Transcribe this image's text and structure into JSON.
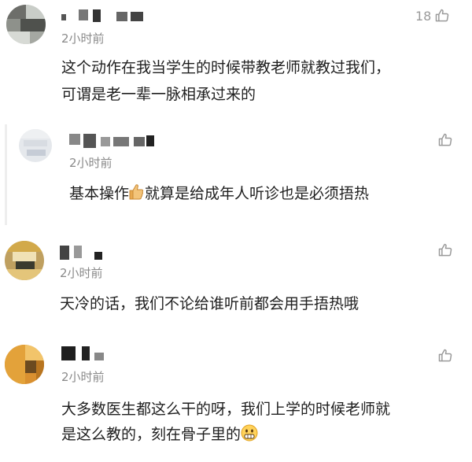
{
  "comments": [
    {
      "time": "2小时前",
      "text_lines": [
        "这个动作在我当学生的时候带教老师就教过我们，",
        "可谓是老一辈一脉相承过来的"
      ],
      "likes": "18",
      "like_icon": "thumbs-up-outline-icon",
      "avatar_colors": [
        "#6d6e6a",
        "#c9cdc8",
        "#8e918b",
        "#4f514d",
        "#d7dad5",
        "#a5a8a2"
      ]
    },
    {
      "time": "2小时前",
      "text_before_emoji": "基本操作",
      "emoji": "thumbs-up-emoji-icon",
      "text_after_emoji": "就算是给成年人听诊也是必须捂热",
      "like_icon": "thumbs-up-outline-icon",
      "avatar_colors": [
        "#eef0f2",
        "#d8dce2",
        "#c6ccd6",
        "#e5e8ec"
      ]
    },
    {
      "time": "2小时前",
      "text": "天冷的话，我们不论给谁听前都会用手捂热哦",
      "like_icon": "thumbs-up-outline-icon",
      "avatar_colors": [
        "#d2a94a",
        "#8a6a2a",
        "#e4c57a",
        "#3a3a2e",
        "#bfa060",
        "#f0e1b5"
      ]
    },
    {
      "time": "2小时前",
      "text_lines": [
        "大多数医生都这么干的呀，我们上学的时候老师就",
        "是这么教的，刻在骨子里的"
      ],
      "emoji": "grimace-face-emoji-icon",
      "like_icon": "thumbs-up-outline-icon",
      "avatar_colors": [
        "#e3a23a",
        "#b87520",
        "#f2c46a",
        "#6b4a20",
        "#d99030"
      ]
    }
  ]
}
